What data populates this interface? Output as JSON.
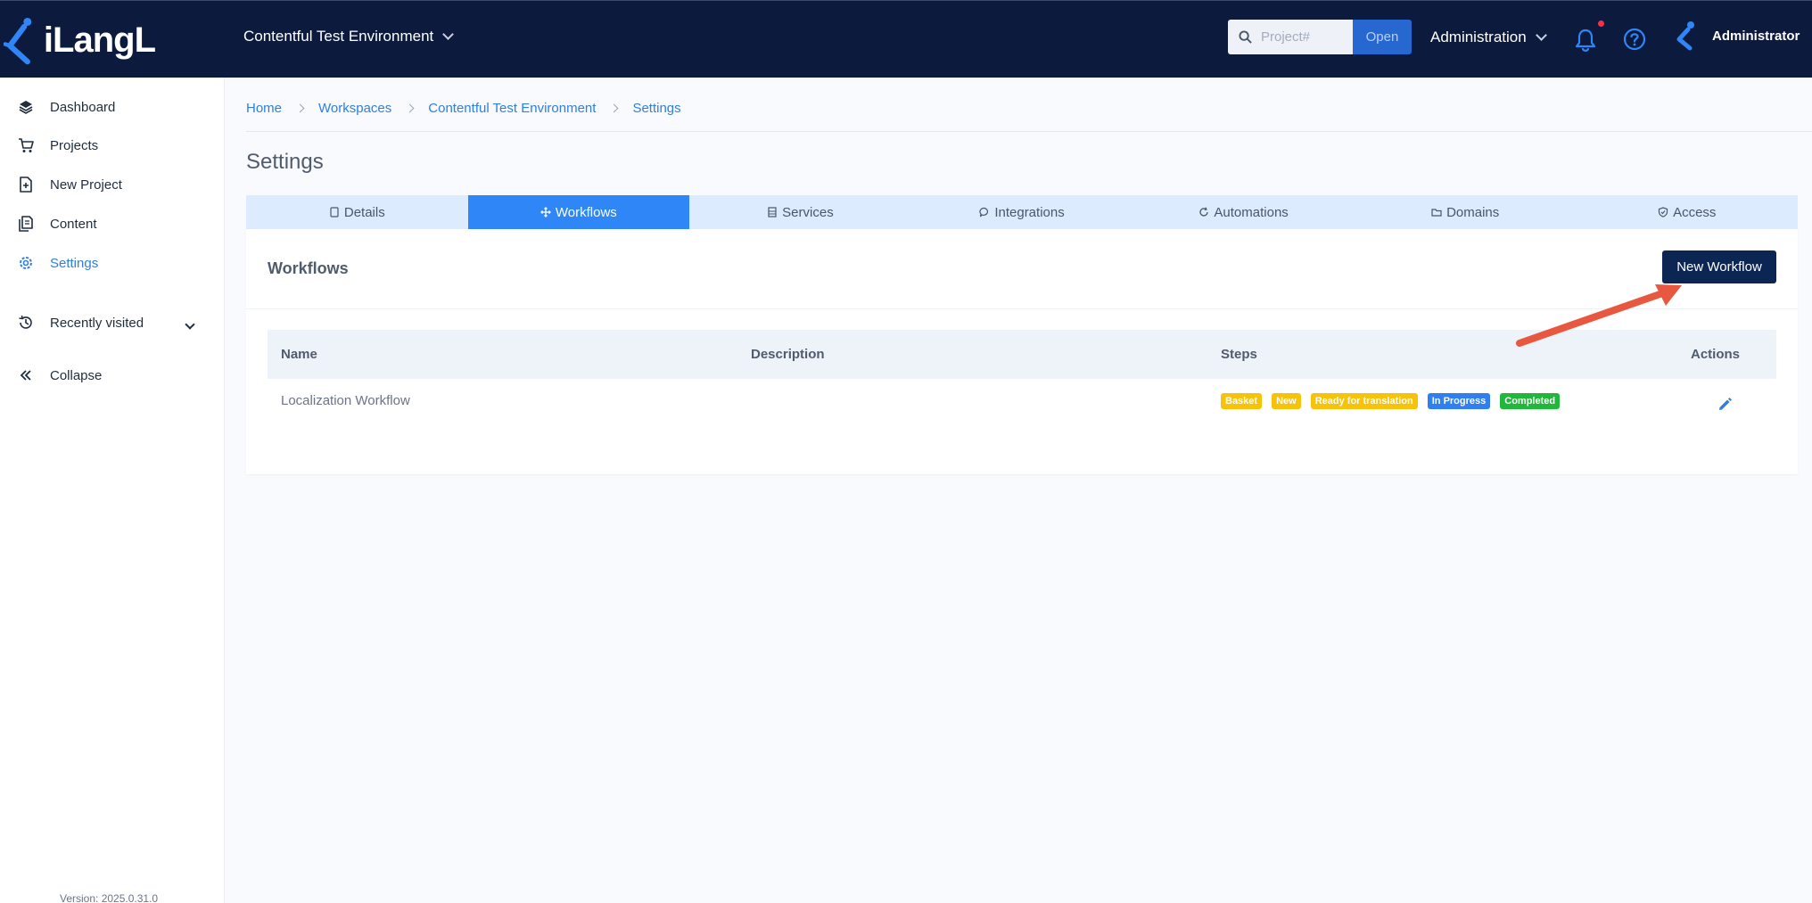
{
  "header": {
    "logo_text": "iLangL",
    "workspace": "Contentful Test Environment",
    "search_placeholder": "Project#",
    "open_label": "Open",
    "admin_menu": "Administration",
    "user_name": "Administrator"
  },
  "sidebar": {
    "items": [
      {
        "label": "Dashboard",
        "icon": "layers-icon"
      },
      {
        "label": "Projects",
        "icon": "cart-icon"
      },
      {
        "label": "New Project",
        "icon": "file-plus-icon"
      },
      {
        "label": "Content",
        "icon": "documents-icon"
      },
      {
        "label": "Settings",
        "icon": "gear-icon",
        "active": true
      }
    ],
    "recently_visited": "Recently visited",
    "collapse": "Collapse",
    "version": "Version: 2025.0.31.0"
  },
  "breadcrumb": [
    "Home",
    "Workspaces",
    "Contentful Test Environment",
    "Settings"
  ],
  "page_title": "Settings",
  "tabs": [
    {
      "label": "Details",
      "icon": "tablet-icon"
    },
    {
      "label": "Workflows",
      "icon": "move-icon",
      "active": true
    },
    {
      "label": "Services",
      "icon": "server-icon"
    },
    {
      "label": "Integrations",
      "icon": "chat-icon"
    },
    {
      "label": "Automations",
      "icon": "refresh-icon"
    },
    {
      "label": "Domains",
      "icon": "folder-icon"
    },
    {
      "label": "Access",
      "icon": "shield-check-icon"
    }
  ],
  "workflows": {
    "title": "Workflows",
    "new_button": "New Workflow",
    "columns": {
      "name": "Name",
      "description": "Description",
      "steps": "Steps",
      "actions": "Actions"
    },
    "rows": [
      {
        "name": "Localization Workflow",
        "description": "",
        "steps": [
          {
            "label": "Basket",
            "color": "#f7c20a"
          },
          {
            "label": "New",
            "color": "#f7c20a"
          },
          {
            "label": "Ready for translation",
            "color": "#f7c20a"
          },
          {
            "label": "In Progress",
            "color": "#2f7ff0"
          },
          {
            "label": "Completed",
            "color": "#1fb83a"
          }
        ]
      }
    ]
  },
  "colors": {
    "topbar": "#0c1a3e",
    "accent": "#2f7fe0",
    "annotation_arrow": "#e8573f"
  }
}
